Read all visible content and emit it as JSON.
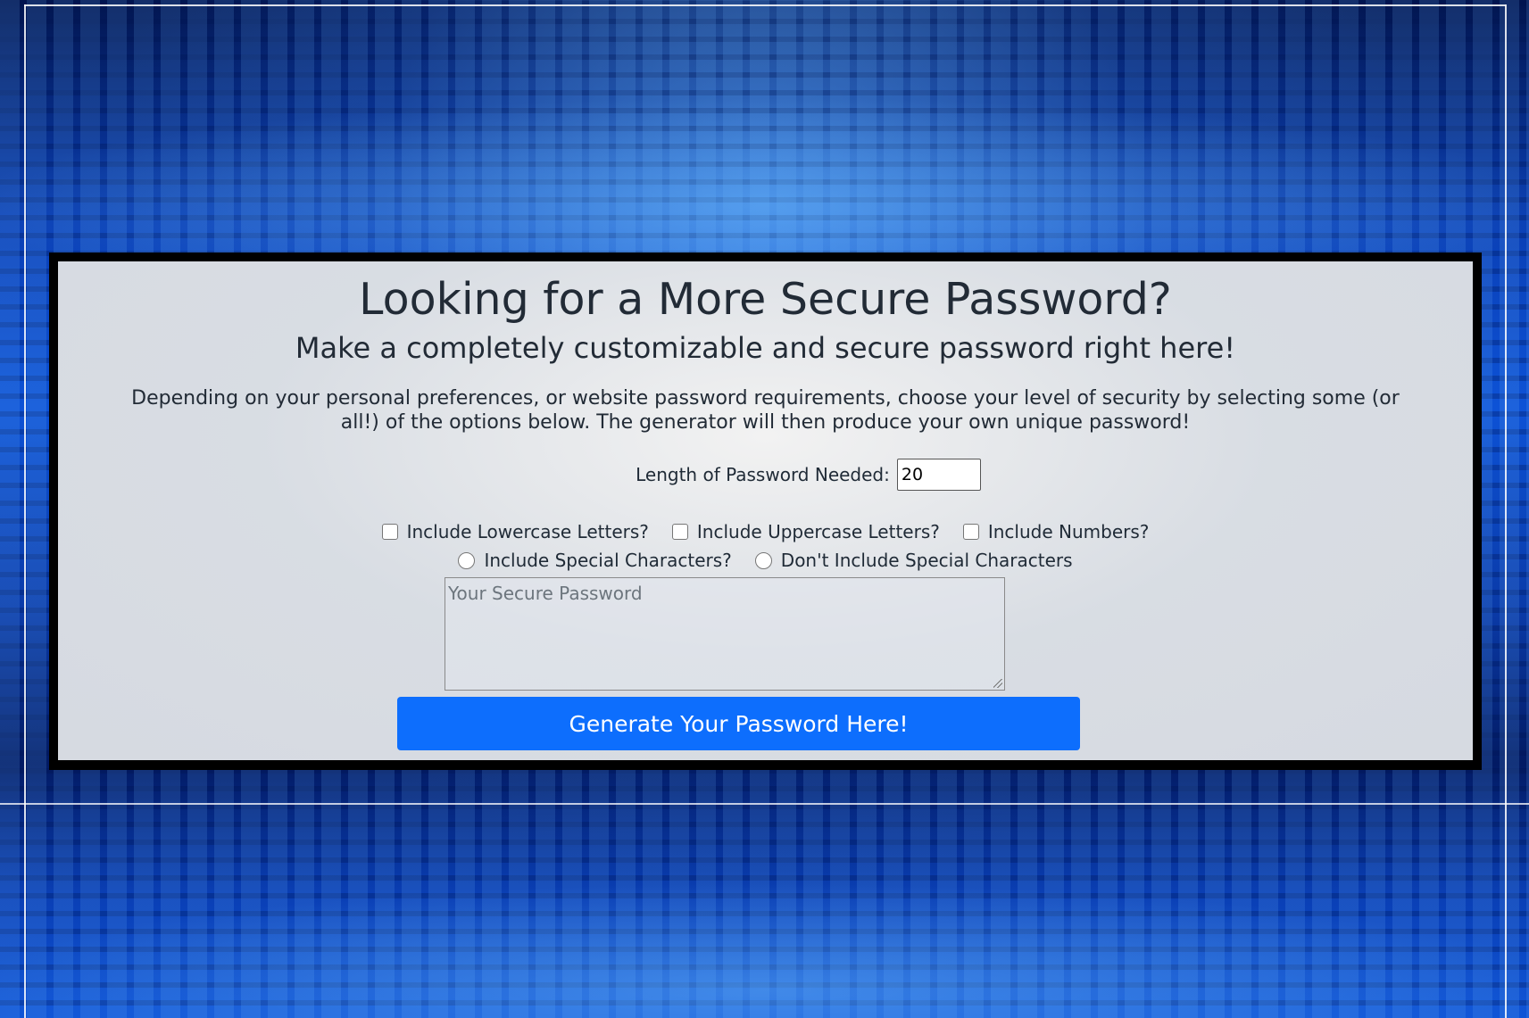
{
  "page": {
    "title": "Looking for a More Secure Password?",
    "subtitle": "Make a completely customizable and secure password right here!",
    "description": "Depending on your personal preferences, or website password requirements, choose your level of security by selecting some (or all!) of the options below. The generator will then produce your own unique password!"
  },
  "length": {
    "label": "Length of Password Needed:",
    "value": "20"
  },
  "options": {
    "lowercase": "Include Lowercase Letters?",
    "uppercase": "Include Uppercase Letters?",
    "numbers": "Include Numbers?",
    "special_yes": "Include Special Characters?",
    "special_no": "Don't Include Special Characters"
  },
  "output": {
    "placeholder": "Your Secure Password"
  },
  "generate_button": {
    "label": "Generate Your Password Here!"
  },
  "colors": {
    "button": "#0d6efd",
    "background": "#0a3fb5",
    "card_border": "#000000"
  }
}
